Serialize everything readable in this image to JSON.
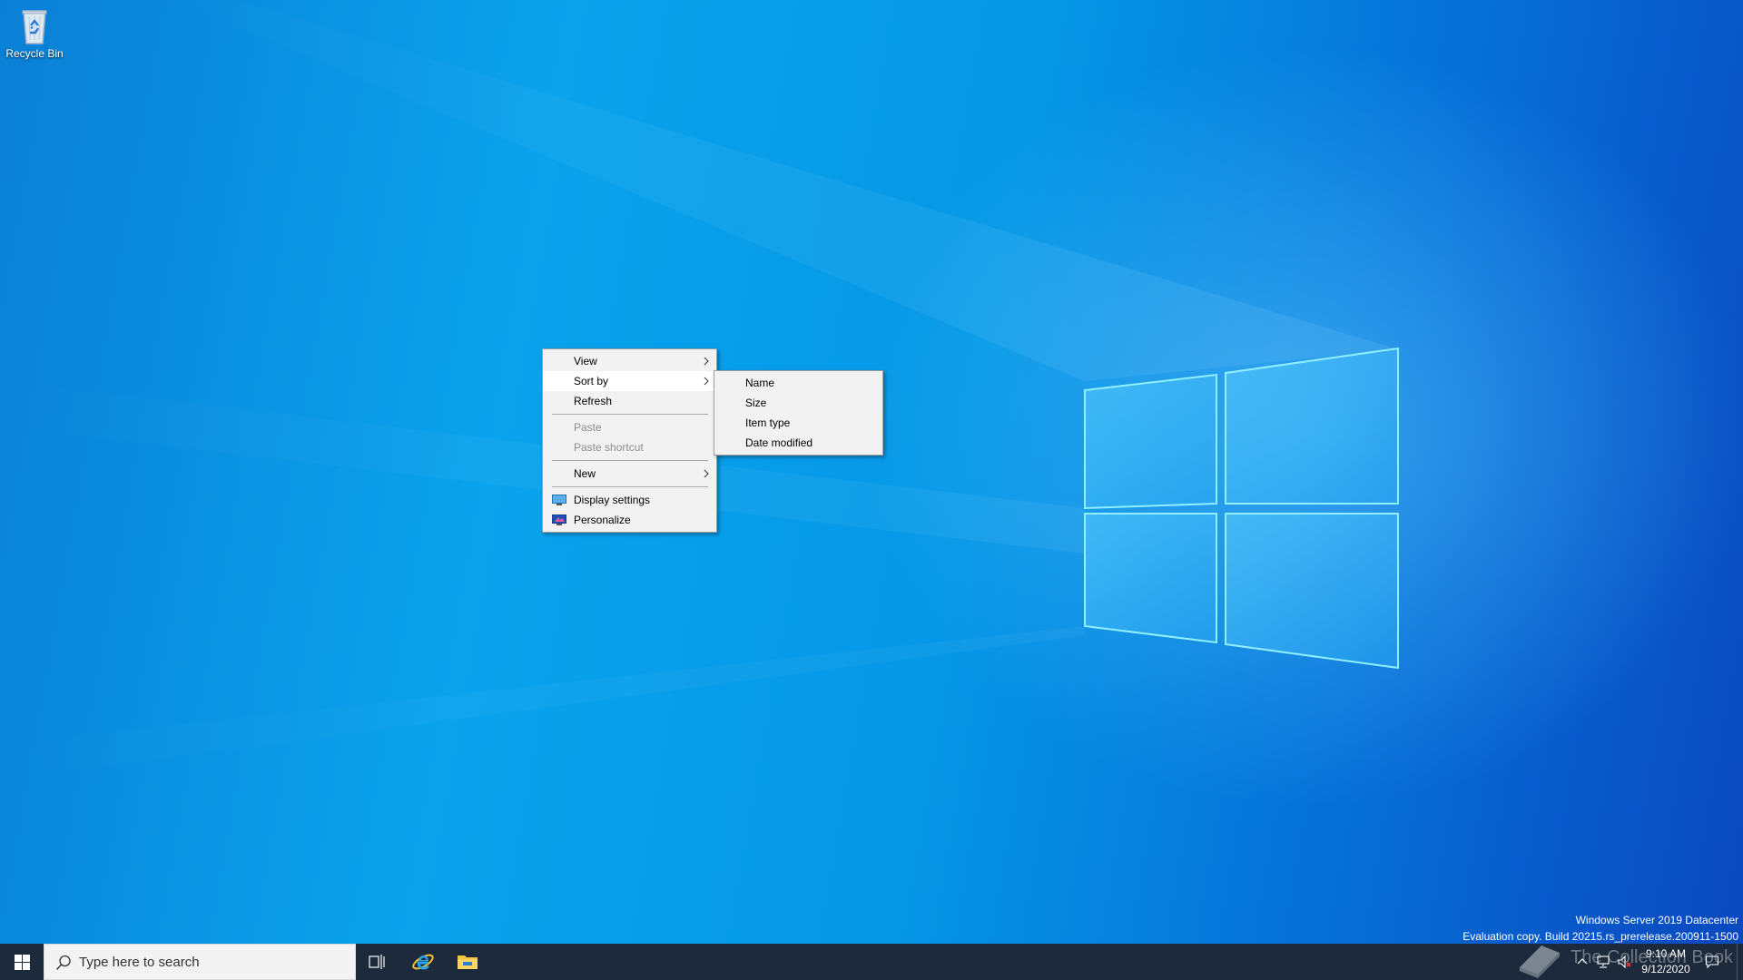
{
  "desktop": {
    "icons": [
      {
        "label": "Recycle Bin",
        "icon": "recycle-bin-icon"
      }
    ],
    "watermark": {
      "line1": "Windows Server 2019 Datacenter",
      "line2": "Evaluation copy. Build 20215.rs_prerelease.200911-1500"
    }
  },
  "context_menu": {
    "items": [
      {
        "label": "View",
        "submenu": true
      },
      {
        "label": "Sort by",
        "submenu": true,
        "active": true
      },
      {
        "label": "Refresh"
      },
      {
        "label": "Paste",
        "disabled": true
      },
      {
        "label": "Paste shortcut",
        "disabled": true
      },
      {
        "label": "New",
        "submenu": true
      },
      {
        "label": "Display settings",
        "icon": "display-settings-icon"
      },
      {
        "label": "Personalize",
        "icon": "personalize-icon"
      }
    ]
  },
  "sort_submenu": {
    "items": [
      {
        "label": "Name"
      },
      {
        "label": "Size"
      },
      {
        "label": "Item type"
      },
      {
        "label": "Date modified"
      }
    ]
  },
  "taskbar": {
    "search_placeholder": "Type here to search",
    "pinned": [
      {
        "name": "task-view",
        "icon": "task-view-icon"
      },
      {
        "name": "internet-explorer",
        "icon": "internet-explorer-icon"
      },
      {
        "name": "file-explorer",
        "icon": "folder-icon"
      }
    ],
    "clock": {
      "time": "9:10 AM",
      "date": "9/12/2020"
    },
    "brand_overlay": "The Collection Book"
  },
  "colors": {
    "taskbar": "#1c2a3b",
    "menu_bg": "#f2f2f2",
    "desktop_accent": "#0aa3ec"
  }
}
